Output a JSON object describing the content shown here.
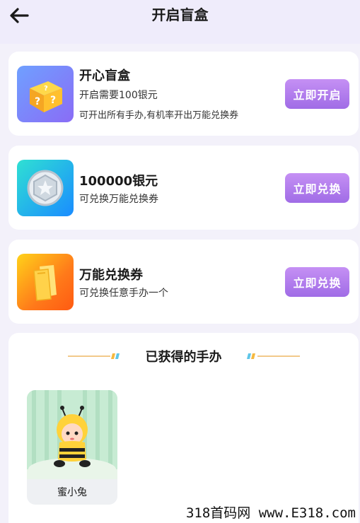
{
  "header": {
    "title": "开启盲盒",
    "back_icon": "arrow-left-icon"
  },
  "cards": [
    {
      "title": "开心盲盒",
      "line1": "开启需要100银元",
      "line2": "可开出所有手办,有机率开出万能兑换券",
      "button": "立即开启",
      "icon": "mystery-box-icon"
    },
    {
      "title": "100000银元",
      "line1": "可兑换万能兑换券",
      "button": "立即兑换",
      "icon": "silver-coin-icon"
    },
    {
      "title": "万能兑换券",
      "line1": "可兑换任意手办一个",
      "button": "立即兑换",
      "icon": "voucher-icon"
    }
  ],
  "obtained": {
    "title": "已获得的手办",
    "items": [
      {
        "name": "蜜小兔"
      }
    ]
  },
  "watermark": "318首码网 www.E318.com",
  "colors": {
    "accent": "#a06ce6",
    "background": "#f3f1fa"
  }
}
